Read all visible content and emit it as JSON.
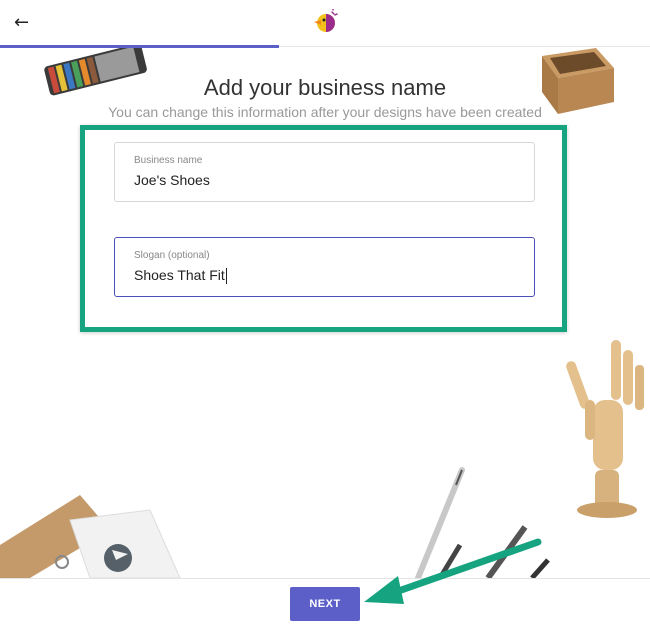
{
  "header": {
    "back_icon": "arrow-left-icon",
    "logo_icon": "brand-bird-logo-icon",
    "progress": 0.43
  },
  "main": {
    "title": "Add your business name",
    "subtitle": "You can change this information after your designs have been created"
  },
  "form": {
    "business_name": {
      "label": "Business name",
      "value": "Joe's Shoes"
    },
    "slogan": {
      "label": "Slogan (optional)",
      "value": "Shoes That Fit"
    }
  },
  "footer": {
    "next_label": "NEXT"
  },
  "colors": {
    "accent": "#5b5fc7",
    "highlight": "#16a37f",
    "arrow": "#16a37f"
  }
}
